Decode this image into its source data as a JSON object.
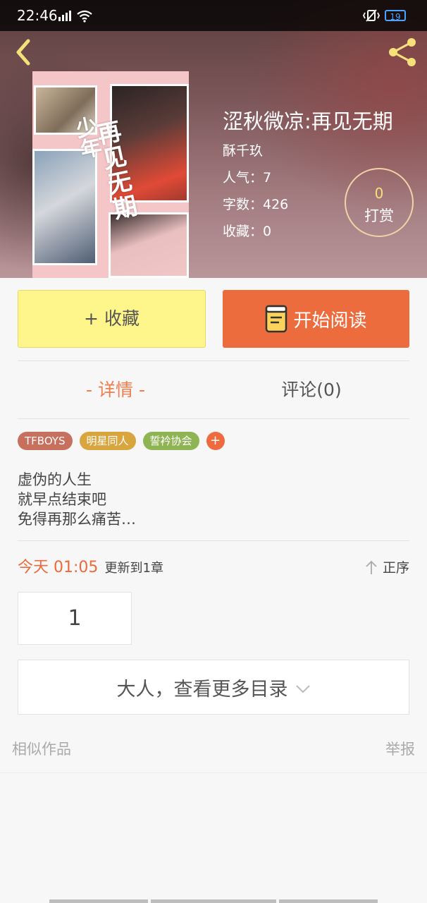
{
  "status_bar": {
    "time": "22:46",
    "battery": "19"
  },
  "book": {
    "title": "涩秋微凉:再见无期",
    "author": "酥千玖",
    "popularity": "人气：7",
    "word_count": "字数：426",
    "favorites": "收藏：0",
    "cover_title": "再见无期",
    "cover_sub": "少年"
  },
  "reward": {
    "count": "0",
    "label": "打赏"
  },
  "actions": {
    "collect_label": "+ 收藏",
    "read_label": "开始阅读"
  },
  "tabs": {
    "detail": "- 详情 -",
    "comment": "评论(0)"
  },
  "tags": [
    {
      "label": "TFBOYS",
      "color": "#c8705e"
    },
    {
      "label": "明星同人",
      "color": "#d9a53f"
    },
    {
      "label": "誓衿协会",
      "color": "#8fb454"
    },
    {
      "label": "+",
      "color": "#ef6a3f"
    }
  ],
  "description": [
    "虚伪的人生",
    "就早点结束吧",
    "免得再那么痛苦…"
  ],
  "update": {
    "time": "今天 01:05",
    "text": "更新到1章",
    "order_label": "正序"
  },
  "chapters": [
    "1"
  ],
  "more_catalog": "大人，查看更多目录",
  "footer": {
    "similar": "相似作品",
    "report": "举报"
  },
  "colors": {
    "accent": "#ec6c3e",
    "collect_bg": "#fef68a"
  }
}
